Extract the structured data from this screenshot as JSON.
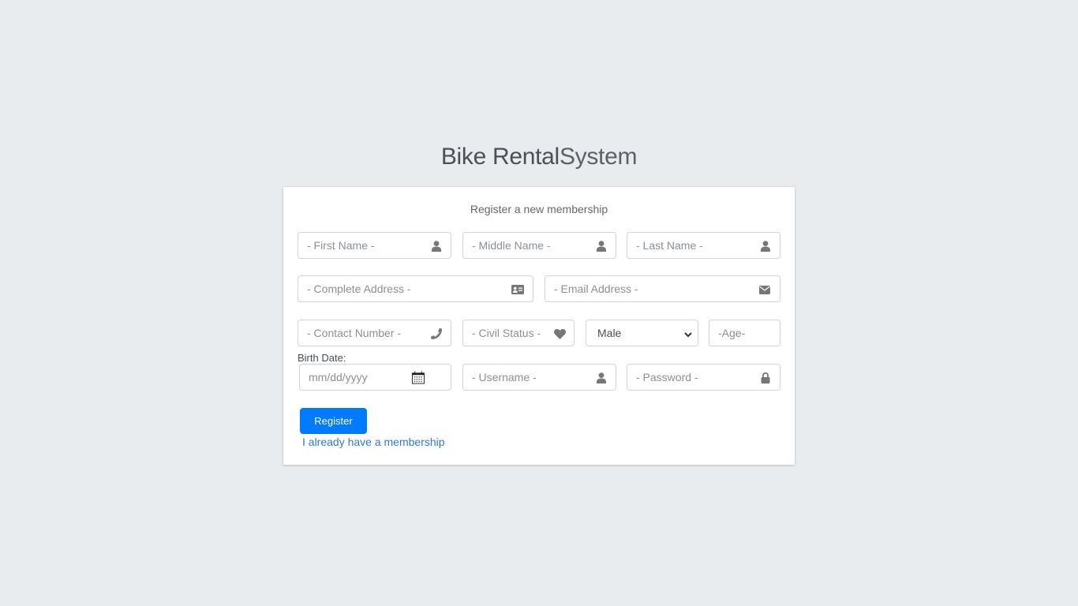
{
  "logo": {
    "bold": "Bike Rental",
    "light": "System"
  },
  "card": {
    "message": "Register a new membership",
    "fields": {
      "first_name": {
        "placeholder": "- First Name -",
        "icon": "user-icon"
      },
      "middle_name": {
        "placeholder": "- Middle Name -",
        "icon": "user-icon"
      },
      "last_name": {
        "placeholder": "- Last Name -",
        "icon": "user-icon"
      },
      "address": {
        "placeholder": "- Complete Address -",
        "icon": "address-card-icon"
      },
      "email": {
        "placeholder": "- Email Address -",
        "icon": "envelope-icon"
      },
      "contact": {
        "placeholder": "- Contact Number -",
        "icon": "phone-icon"
      },
      "civil_status": {
        "placeholder": "- Civil Status -",
        "icon": "heart-icon"
      },
      "gender": {
        "value": "Male",
        "options": [
          "Male"
        ]
      },
      "age": {
        "placeholder": "-Age-"
      },
      "birth_date": {
        "label": "Birth Date:",
        "placeholder": "mm/dd/yyyy",
        "icon": "calendar-icon"
      },
      "username": {
        "placeholder": "- Username -",
        "icon": "user-icon"
      },
      "password": {
        "placeholder": "- Password -",
        "icon": "lock-icon"
      }
    },
    "register_label": "Register",
    "login_link": "I already have a membership"
  },
  "colors": {
    "primary": "#007bff",
    "background": "#e9ecef",
    "link": "#2d7ad6"
  }
}
